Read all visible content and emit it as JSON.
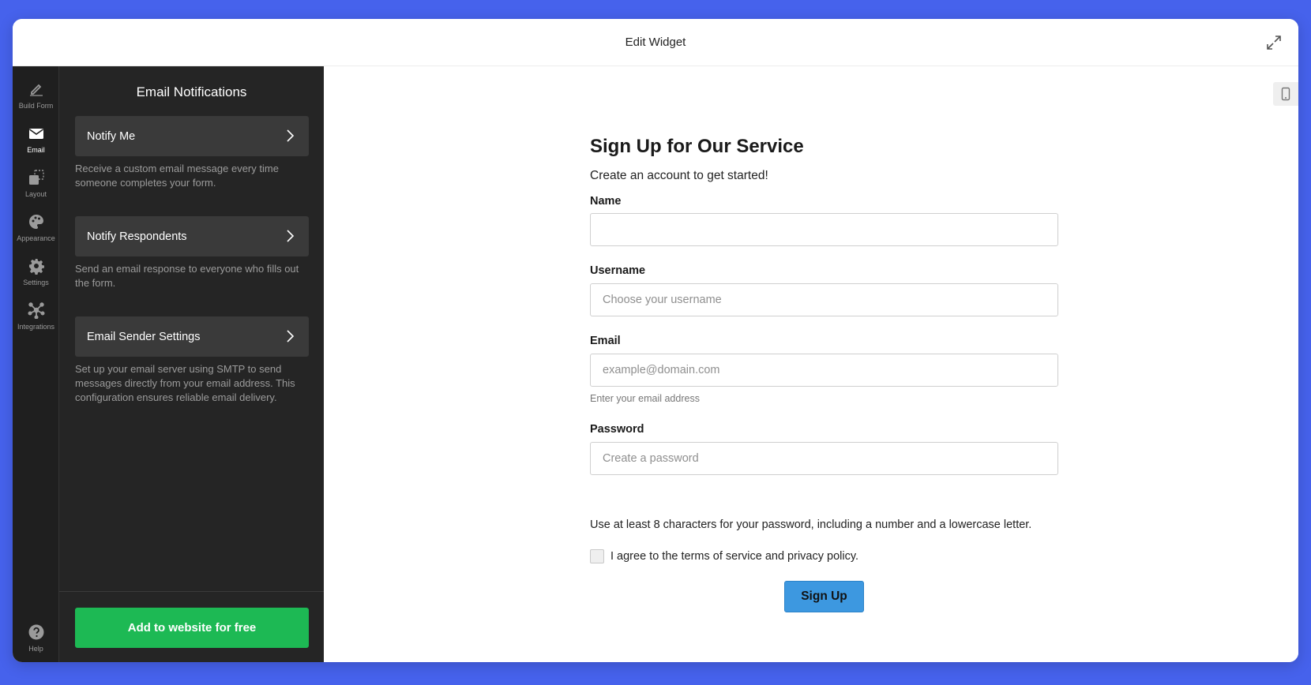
{
  "window": {
    "title": "Edit Widget"
  },
  "rail": {
    "items": [
      {
        "label": "Build Form",
        "icon": "pencil-icon"
      },
      {
        "label": "Email",
        "icon": "envelope-icon",
        "active": true
      },
      {
        "label": "Layout",
        "icon": "layout-icon"
      },
      {
        "label": "Appearance",
        "icon": "palette-icon"
      },
      {
        "label": "Settings",
        "icon": "gear-icon"
      },
      {
        "label": "Integrations",
        "icon": "integrations-icon"
      }
    ],
    "help": {
      "label": "Help",
      "icon": "help-icon"
    }
  },
  "panel": {
    "title": "Email Notifications",
    "cards": [
      {
        "label": "Notify Me",
        "description": "Receive a custom email message every time someone completes your form."
      },
      {
        "label": "Notify Respondents",
        "description": "Send an email response to everyone who fills out the form."
      },
      {
        "label": "Email Sender Settings",
        "description": "Set up your email server using SMTP to send messages directly from your email address. This configuration ensures reliable email delivery."
      }
    ],
    "cta_label": "Add to website for free"
  },
  "form": {
    "title": "Sign Up for Our Service",
    "subtitle": "Create an account to get started!",
    "fields": {
      "name": {
        "label": "Name",
        "placeholder": "",
        "value": ""
      },
      "username": {
        "label": "Username",
        "placeholder": "Choose your username",
        "value": ""
      },
      "email": {
        "label": "Email",
        "placeholder": "example@domain.com",
        "value": "",
        "help": "Enter your email address"
      },
      "password": {
        "label": "Password",
        "placeholder": "Create a password",
        "value": ""
      }
    },
    "password_hint": "Use at least 8 characters for your password, including a number and a lowercase letter.",
    "agree_label": "I agree to the terms of service and privacy policy.",
    "agree_checked": false,
    "submit_label": "Sign Up"
  },
  "colors": {
    "background": "#4662ec",
    "sidebar": "#252525",
    "rail": "#1f1f1f",
    "cta": "#1db954",
    "submit": "#3d98e0"
  }
}
